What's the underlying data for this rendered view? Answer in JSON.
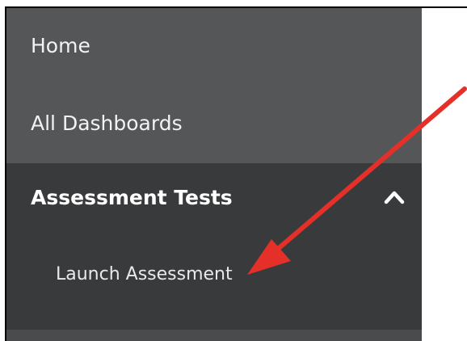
{
  "sidebar": {
    "items": [
      {
        "label": "Home"
      },
      {
        "label": "All Dashboards"
      }
    ],
    "section": {
      "title": "Assessment Tests",
      "expanded": true,
      "toggle_icon": "chevron-up-icon",
      "subitems": [
        {
          "label": "Launch Assessment"
        }
      ]
    }
  },
  "annotation": {
    "type": "arrow",
    "color": "#e5302a",
    "points_to": "Launch Assessment"
  },
  "colors": {
    "sidebar_bg": "#555657",
    "section_bg": "#393a3c",
    "text": "#f2f2f2",
    "arrow": "#e5302a"
  }
}
